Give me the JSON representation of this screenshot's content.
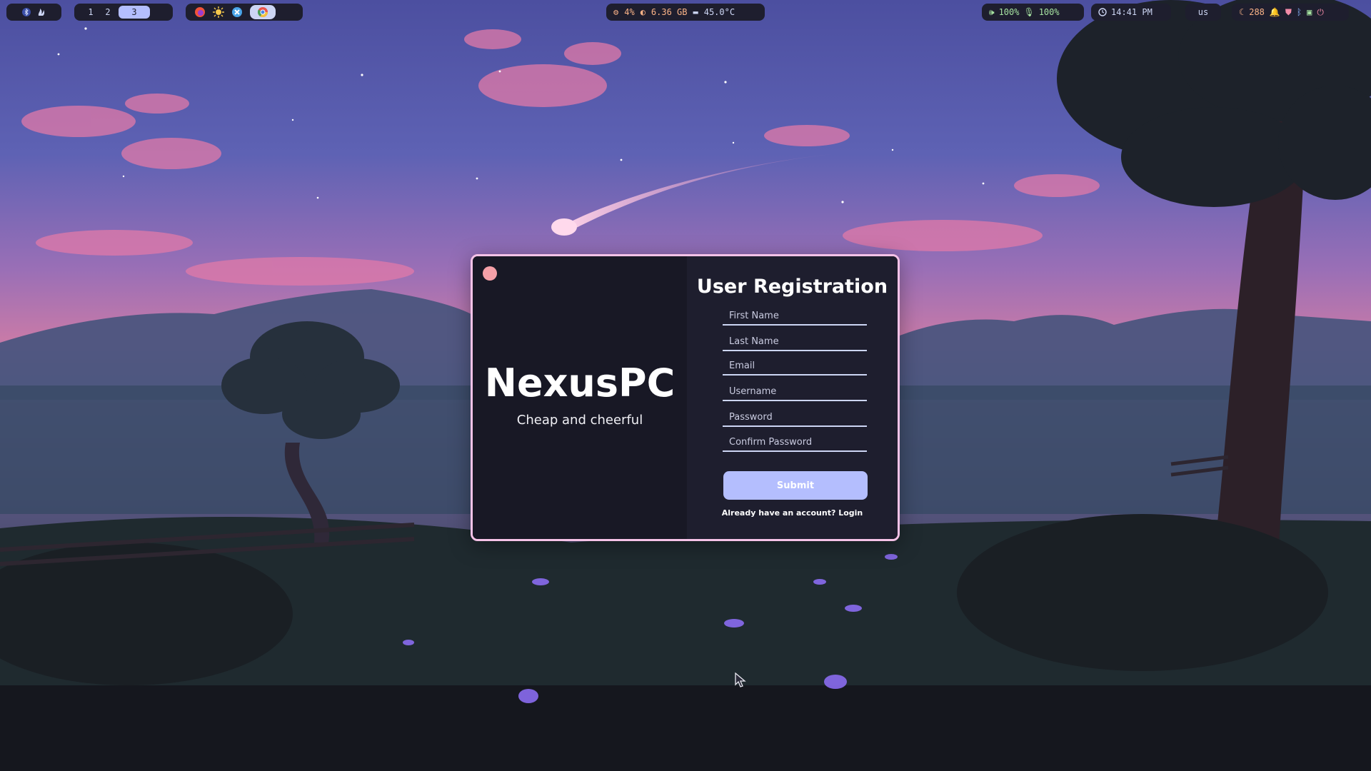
{
  "topbar": {
    "workspaces": [
      "1",
      "2",
      "3"
    ],
    "active_workspace": "3",
    "system": {
      "cpu": "4%",
      "memory": "6.36 GB",
      "temperature": "45.0°C"
    },
    "audio": {
      "volume": "100%",
      "mic": "100%"
    },
    "clock": "14:41 PM",
    "keyboard_layout": "us",
    "updates_count": "288"
  },
  "colors": {
    "accent": "#b4befe",
    "window_border": "#f5c2e7",
    "close_dot": "#f5a0a8",
    "panel_dark": "#181825",
    "panel": "#1e1e2e"
  },
  "window": {
    "brand_title": "NexusPC",
    "brand_tagline": "Cheap and cheerful",
    "form_title": "User Registration",
    "fields": {
      "first_name": "First Name",
      "last_name": "Last Name",
      "email": "Email",
      "username": "Username",
      "password": "Password",
      "confirm_password": "Confirm Password"
    },
    "submit_label": "Submit",
    "login_prompt": "Already have an account?",
    "login_link": "Login"
  },
  "icons": {
    "left_pill": [
      "bluetooth-icon",
      "flame-icon"
    ],
    "apps": [
      "firefox-icon",
      "sun-app-icon",
      "vscode-icon",
      "chrome-icon"
    ],
    "system": [
      "cpu-icon",
      "memory-icon",
      "thermometer-icon"
    ],
    "audio": [
      "speaker-icon",
      "microphone-icon"
    ],
    "clock": "clock-icon",
    "tray": [
      "moon-icon",
      "notification-icon",
      "shield-icon",
      "bluetooth-icon",
      "display-icon",
      "power-icon"
    ]
  }
}
